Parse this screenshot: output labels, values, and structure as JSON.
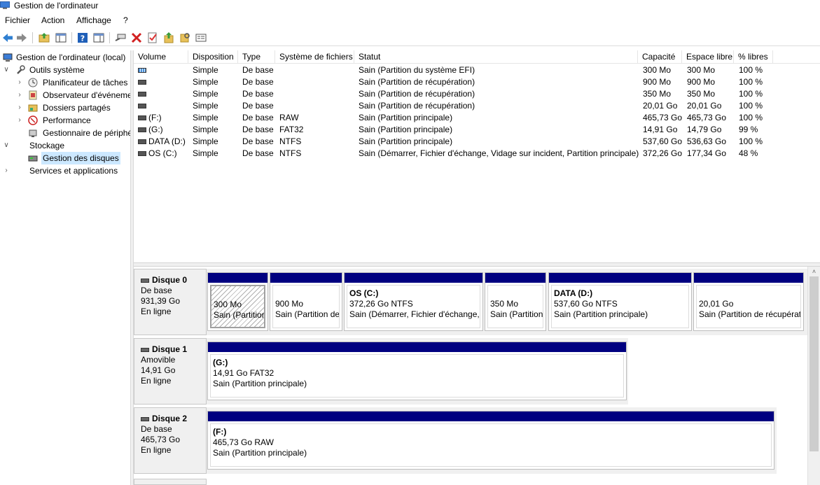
{
  "window": {
    "title": "Gestion de l'ordinateur"
  },
  "menu": [
    "Fichier",
    "Action",
    "Affichage",
    "?"
  ],
  "toolbar": {
    "icons": [
      "back-arrow-icon",
      "forward-arrow-icon",
      "up-folder-icon",
      "show-hide-console-tree-icon",
      "help-icon",
      "properties-pane-icon",
      "connect-icon",
      "delete-icon",
      "checkmark-icon",
      "export-icon",
      "search-icon",
      "properties-icon"
    ]
  },
  "tree": [
    {
      "label": "Gestion de l'ordinateur (local)",
      "icon": "computer-icon"
    },
    {
      "label": "Outils système",
      "icon": "tools-icon"
    },
    {
      "label": "Planificateur de tâches",
      "icon": "clock-icon"
    },
    {
      "label": "Observateur d'événeme",
      "icon": "event-viewer-icon"
    },
    {
      "label": "Dossiers partagés",
      "icon": "shared-folders-icon"
    },
    {
      "label": "Performance",
      "icon": "performance-icon"
    },
    {
      "label": "Gestionnaire de périphé",
      "icon": "device-manager-icon"
    },
    {
      "label": "Stockage",
      "icon": "storage-icon"
    },
    {
      "label": "Gestion des disques",
      "icon": "disk-management-icon"
    },
    {
      "label": "Services et applications",
      "icon": "services-icon"
    }
  ],
  "volumes": {
    "columns": [
      "Volume",
      "Disposition",
      "Type",
      "Système de fichiers",
      "Statut",
      "Capacité",
      "Espace libre",
      "% libres"
    ],
    "rows": [
      {
        "volume": "",
        "layout": "Simple",
        "type": "De base",
        "fs": "",
        "status": "Sain (Partition du système EFI)",
        "capacity": "300 Mo",
        "free": "300 Mo",
        "pct": "100 %"
      },
      {
        "volume": "",
        "layout": "Simple",
        "type": "De base",
        "fs": "",
        "status": "Sain (Partition de récupération)",
        "capacity": "900 Mo",
        "free": "900 Mo",
        "pct": "100 %"
      },
      {
        "volume": "",
        "layout": "Simple",
        "type": "De base",
        "fs": "",
        "status": "Sain (Partition de récupération)",
        "capacity": "350 Mo",
        "free": "350 Mo",
        "pct": "100 %"
      },
      {
        "volume": "",
        "layout": "Simple",
        "type": "De base",
        "fs": "",
        "status": "Sain (Partition de récupération)",
        "capacity": "20,01 Go",
        "free": "20,01 Go",
        "pct": "100 %"
      },
      {
        "volume": "(F:)",
        "layout": "Simple",
        "type": "De base",
        "fs": "RAW",
        "status": "Sain (Partition principale)",
        "capacity": "465,73 Go",
        "free": "465,73 Go",
        "pct": "100 %"
      },
      {
        "volume": "(G:)",
        "layout": "Simple",
        "type": "De base",
        "fs": "FAT32",
        "status": "Sain (Partition principale)",
        "capacity": "14,91 Go",
        "free": "14,79 Go",
        "pct": "99 %"
      },
      {
        "volume": "DATA (D:)",
        "layout": "Simple",
        "type": "De base",
        "fs": "NTFS",
        "status": "Sain (Partition principale)",
        "capacity": "537,60 Go",
        "free": "536,63 Go",
        "pct": "100 %"
      },
      {
        "volume": "OS (C:)",
        "layout": "Simple",
        "type": "De base",
        "fs": "NTFS",
        "status": "Sain (Démarrer, Fichier d'échange, Vidage sur incident, Partition principale)",
        "capacity": "372,26 Go",
        "free": "177,34 Go",
        "pct": "48 %"
      }
    ]
  },
  "disks": [
    {
      "name": "Disque 0",
      "kind": "De base",
      "size": "931,39 Go",
      "state": "En ligne",
      "partitions": [
        {
          "label": "",
          "size": "300 Mo",
          "status": "Sain (Partition",
          "hatched": true
        },
        {
          "label": "",
          "size": "900 Mo",
          "status": "Sain (Partition de"
        },
        {
          "label": "OS  (C:)",
          "size": "372,26 Go NTFS",
          "status": "Sain (Démarrer, Fichier d'échange, \\"
        },
        {
          "label": "",
          "size": "350 Mo",
          "status": "Sain (Partition"
        },
        {
          "label": "DATA  (D:)",
          "size": "537,60 Go NTFS",
          "status": "Sain (Partition principale)"
        },
        {
          "label": "",
          "size": "20,01 Go",
          "status": "Sain (Partition de récupérat"
        }
      ]
    },
    {
      "name": "Disque 1",
      "kind": "Amovible",
      "size": "14,91 Go",
      "state": "En ligne",
      "partitions": [
        {
          "label": "(G:)",
          "size": "14,91 Go FAT32",
          "status": "Sain (Partition principale)"
        }
      ]
    },
    {
      "name": "Disque 2",
      "kind": "De base",
      "size": "465,73 Go",
      "state": "En ligne",
      "partitions": [
        {
          "label": "(F:)",
          "size": "465,73 Go RAW",
          "status": "Sain (Partition principale)"
        }
      ]
    }
  ]
}
